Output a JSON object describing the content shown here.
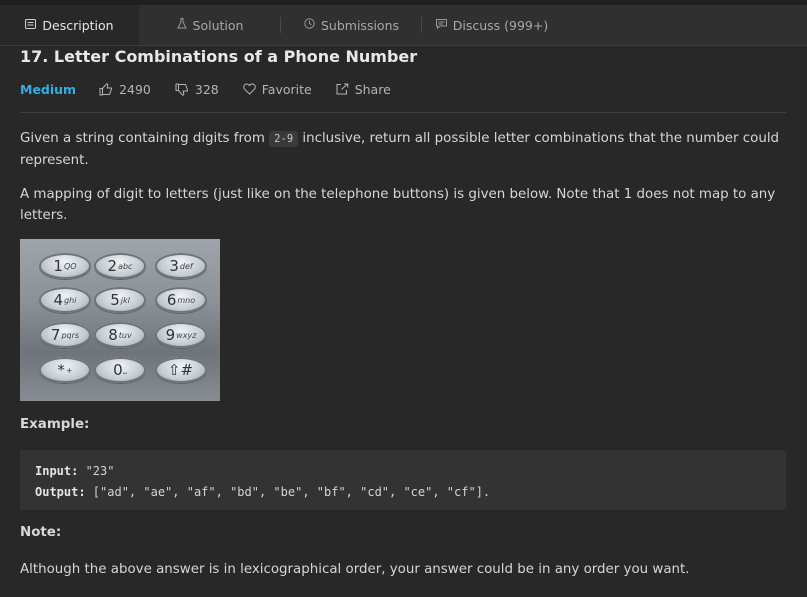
{
  "tabs": [
    {
      "label": "Description",
      "icon": "document-icon",
      "active": true
    },
    {
      "label": "Solution",
      "icon": "flask-icon",
      "active": false
    },
    {
      "label": "Submissions",
      "icon": "clock-icon",
      "active": false
    },
    {
      "label": "Discuss (999+)",
      "icon": "chat-icon",
      "active": false
    }
  ],
  "problem": {
    "title": "17. Letter Combinations of a Phone Number",
    "difficulty": "Medium",
    "likes": "2490",
    "dislikes": "328",
    "favorite_label": "Favorite",
    "share_label": "Share"
  },
  "description": {
    "p1_before": "Given a string containing digits from ",
    "p1_code": "2-9",
    "p1_after": " inclusive, return all possible letter combinations that the number could represent.",
    "p2": "A mapping of digit to letters (just like on the telephone buttons) is given below. Note that 1 does not map to any letters."
  },
  "keypad": [
    {
      "digit": "1",
      "letters": "QO"
    },
    {
      "digit": "2",
      "letters": "abc"
    },
    {
      "digit": "3",
      "letters": "def"
    },
    {
      "digit": "4",
      "letters": "ghi"
    },
    {
      "digit": "5",
      "letters": "jkl"
    },
    {
      "digit": "6",
      "letters": "mno"
    },
    {
      "digit": "7",
      "letters": "pqrs"
    },
    {
      "digit": "8",
      "letters": "tuv"
    },
    {
      "digit": "9",
      "letters": "wxyz"
    },
    {
      "digit": "*",
      "letters": "+"
    },
    {
      "digit": "0",
      "letters": "⎵"
    },
    {
      "digit": "⇧#",
      "letters": ""
    }
  ],
  "example": {
    "heading": "Example:",
    "input_label": "Input:",
    "input_value": " \"23\"",
    "output_label": "Output:",
    "output_value": " [\"ad\", \"ae\", \"af\", \"bd\", \"be\", \"bf\", \"cd\", \"ce\", \"cf\"]."
  },
  "note": {
    "heading": "Note:",
    "text": "Although the above answer is in lexicographical order, your answer could be in any order you want."
  },
  "colors": {
    "background": "#282828",
    "accent_medium": "#2db0e8"
  }
}
